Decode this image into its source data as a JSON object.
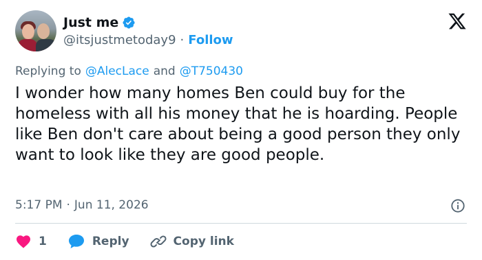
{
  "author": {
    "display_name": "Just me",
    "handle": "@itsjustmetoday9",
    "separator": "·",
    "follow_label": "Follow"
  },
  "reply_context": {
    "prefix": "Replying to",
    "mention1": "@AlecLace",
    "conjunction": "and",
    "mention2": "@T750430"
  },
  "tweet": {
    "text": "I wonder how many homes Ben could buy for the homeless with all his money that he is hoarding. People like Ben don't care about being a good person they only want to look like they are good people."
  },
  "meta": {
    "time": "5:17 PM",
    "separator": "·",
    "date": "Jun 11, 2026"
  },
  "actions": {
    "like_count": "1",
    "reply_label": "Reply",
    "copy_link_label": "Copy link"
  },
  "colors": {
    "accent": "#1d9bf0",
    "like": "#f91880",
    "secondary_text": "#536471"
  },
  "icons": [
    "verified-badge-icon",
    "x-logo-icon",
    "info-icon",
    "heart-icon",
    "reply-bubble-icon",
    "link-icon"
  ]
}
